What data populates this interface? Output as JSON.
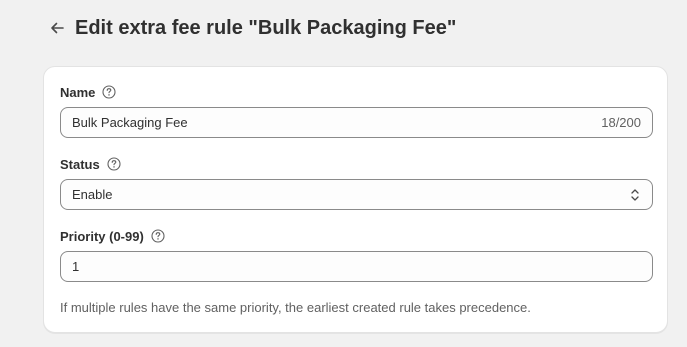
{
  "header": {
    "title": "Edit extra fee rule \"Bulk Packaging Fee\""
  },
  "form": {
    "name": {
      "label": "Name",
      "value": "Bulk Packaging Fee",
      "char_count": "18/200"
    },
    "status": {
      "label": "Status",
      "selected": "Enable"
    },
    "priority": {
      "label": "Priority (0-99)",
      "value": "1",
      "help_text": "If multiple rules have the same priority, the earliest created rule takes precedence."
    }
  },
  "icons": {
    "back": "arrow-left-icon",
    "help": "question-circle-icon",
    "select": "select-chevrons-icon"
  }
}
